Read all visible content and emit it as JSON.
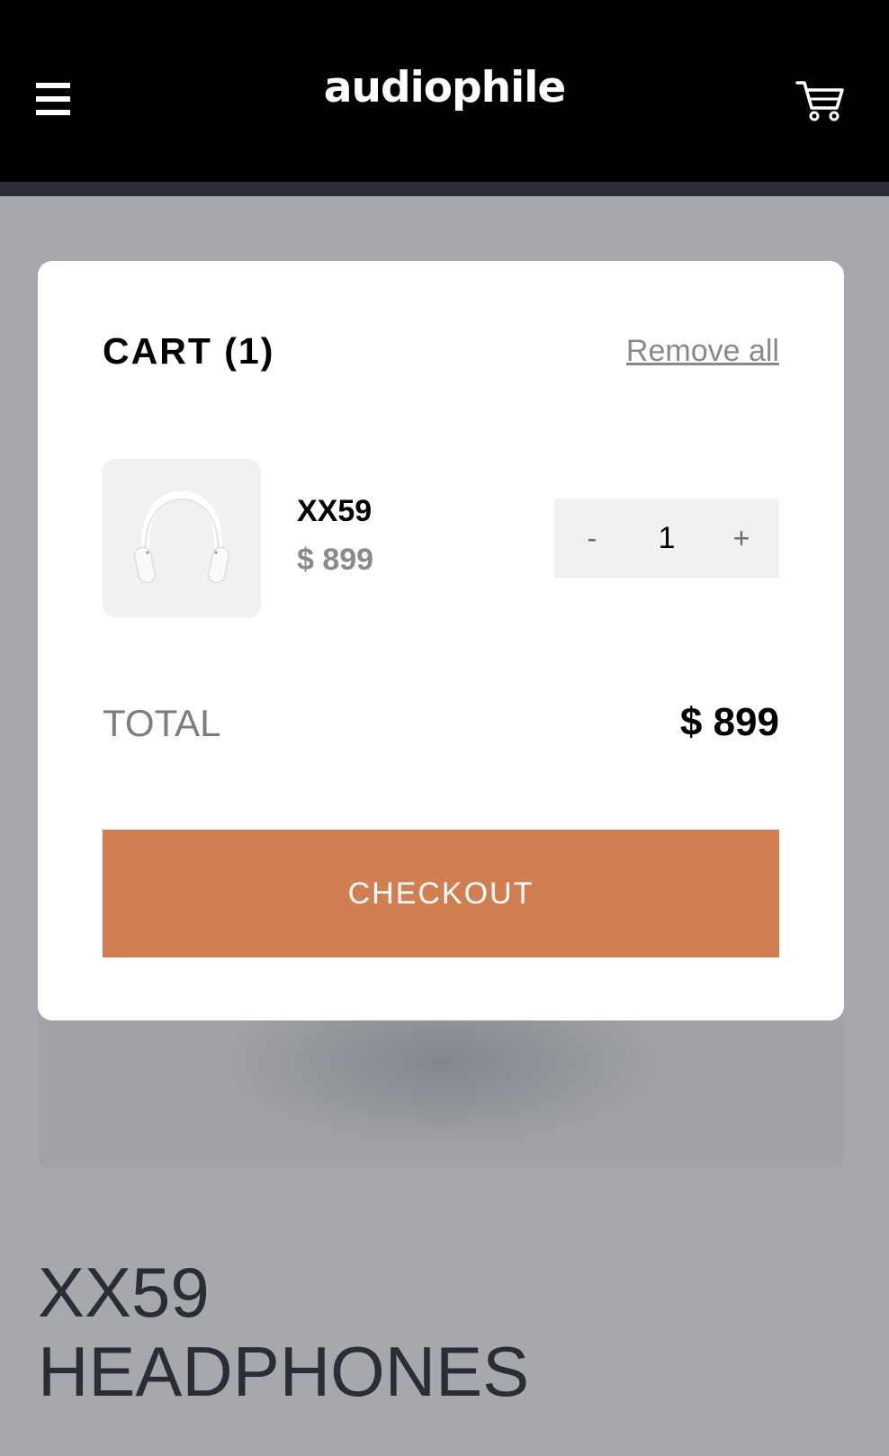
{
  "header": {
    "logo": "audiophile",
    "menu_icon": "hamburger-menu-icon",
    "cart_icon": "shopping-cart-icon",
    "background_color": "#000000"
  },
  "cart": {
    "title": "CART (1)",
    "remove_all_label": "Remove all",
    "items": [
      {
        "name": "XX59",
        "price": "$ 899",
        "quantity": "1",
        "decrement_label": "-",
        "increment_label": "+",
        "image_icon": "white-headphones-image"
      }
    ],
    "total_label": "TOTAL",
    "total_value": "$ 899",
    "checkout_label": "CHECKOUT",
    "accent_color": "#d17f51"
  },
  "page": {
    "product_title_line1": "XX59",
    "product_title_line2": "HEADPHONES",
    "overlay_color": "#a6a8ae"
  }
}
